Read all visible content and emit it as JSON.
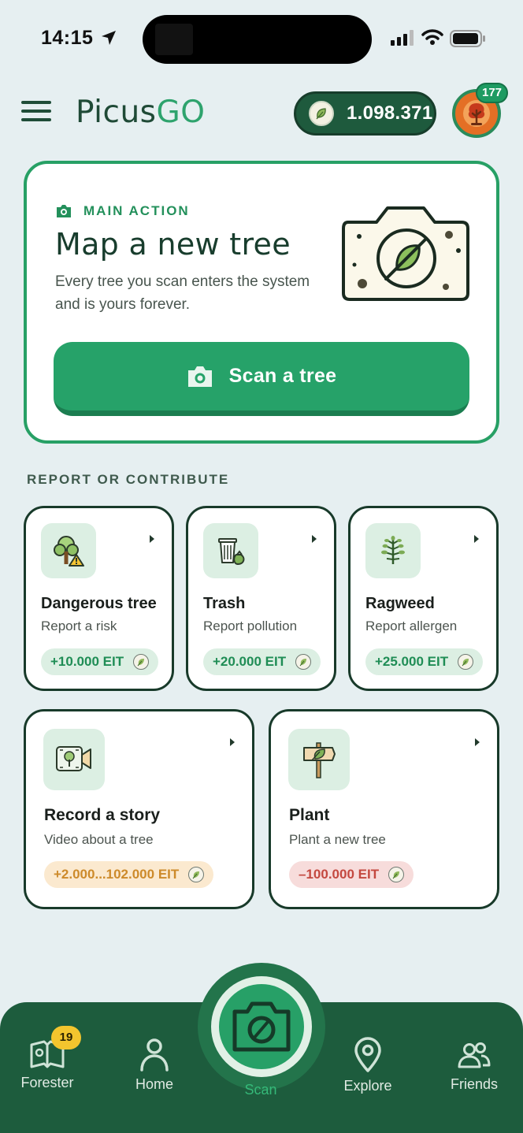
{
  "status_bar": {
    "time": "14:15"
  },
  "header": {
    "logo_part1": "Picus",
    "logo_part2": "GO",
    "balance": "1.098.371",
    "avatar_badge": "177"
  },
  "main_card": {
    "tag": "MAIN ACTION",
    "title": "Map a new tree",
    "description": "Every tree you scan enters the system and is yours forever.",
    "button_label": "Scan a tree"
  },
  "section_title": "REPORT OR CONTRIBUTE",
  "cards": [
    {
      "title": "Dangerous tree",
      "subtitle": "Report a risk",
      "reward": "+10.000 EIT",
      "icon": "dangerous-tree-icon",
      "reward_color": "#1f8d55"
    },
    {
      "title": "Trash",
      "subtitle": "Report pollution",
      "reward": "+20.000 EIT",
      "icon": "trash-icon",
      "reward_color": "#1f8d55"
    },
    {
      "title": "Ragweed",
      "subtitle": "Report allergen",
      "reward": "+25.000 EIT",
      "icon": "ragweed-icon",
      "reward_color": "#1f8d55"
    },
    {
      "title": "Record a story",
      "subtitle": "Video about a tree",
      "reward": "+2.000...102.000 EIT",
      "icon": "video-tree-icon",
      "reward_color": "#cd8a2a"
    },
    {
      "title": "Plant",
      "subtitle": "Plant a new tree",
      "reward": "–100.000 EIT",
      "icon": "signpost-leaf-icon",
      "reward_color": "#c4483f"
    }
  ],
  "bottom_nav": {
    "items": [
      {
        "label": "Forester",
        "icon": "book-map-icon",
        "badge": "19"
      },
      {
        "label": "Home",
        "icon": "person-icon"
      },
      {
        "label": "Scan",
        "icon": "camera-icon",
        "active": true
      },
      {
        "label": "Explore",
        "icon": "location-pin-icon"
      },
      {
        "label": "Friends",
        "icon": "friends-icon"
      }
    ]
  },
  "colors": {
    "accent": "#27a065",
    "dark_green": "#1d5c3d",
    "background": "#e6eff1"
  }
}
